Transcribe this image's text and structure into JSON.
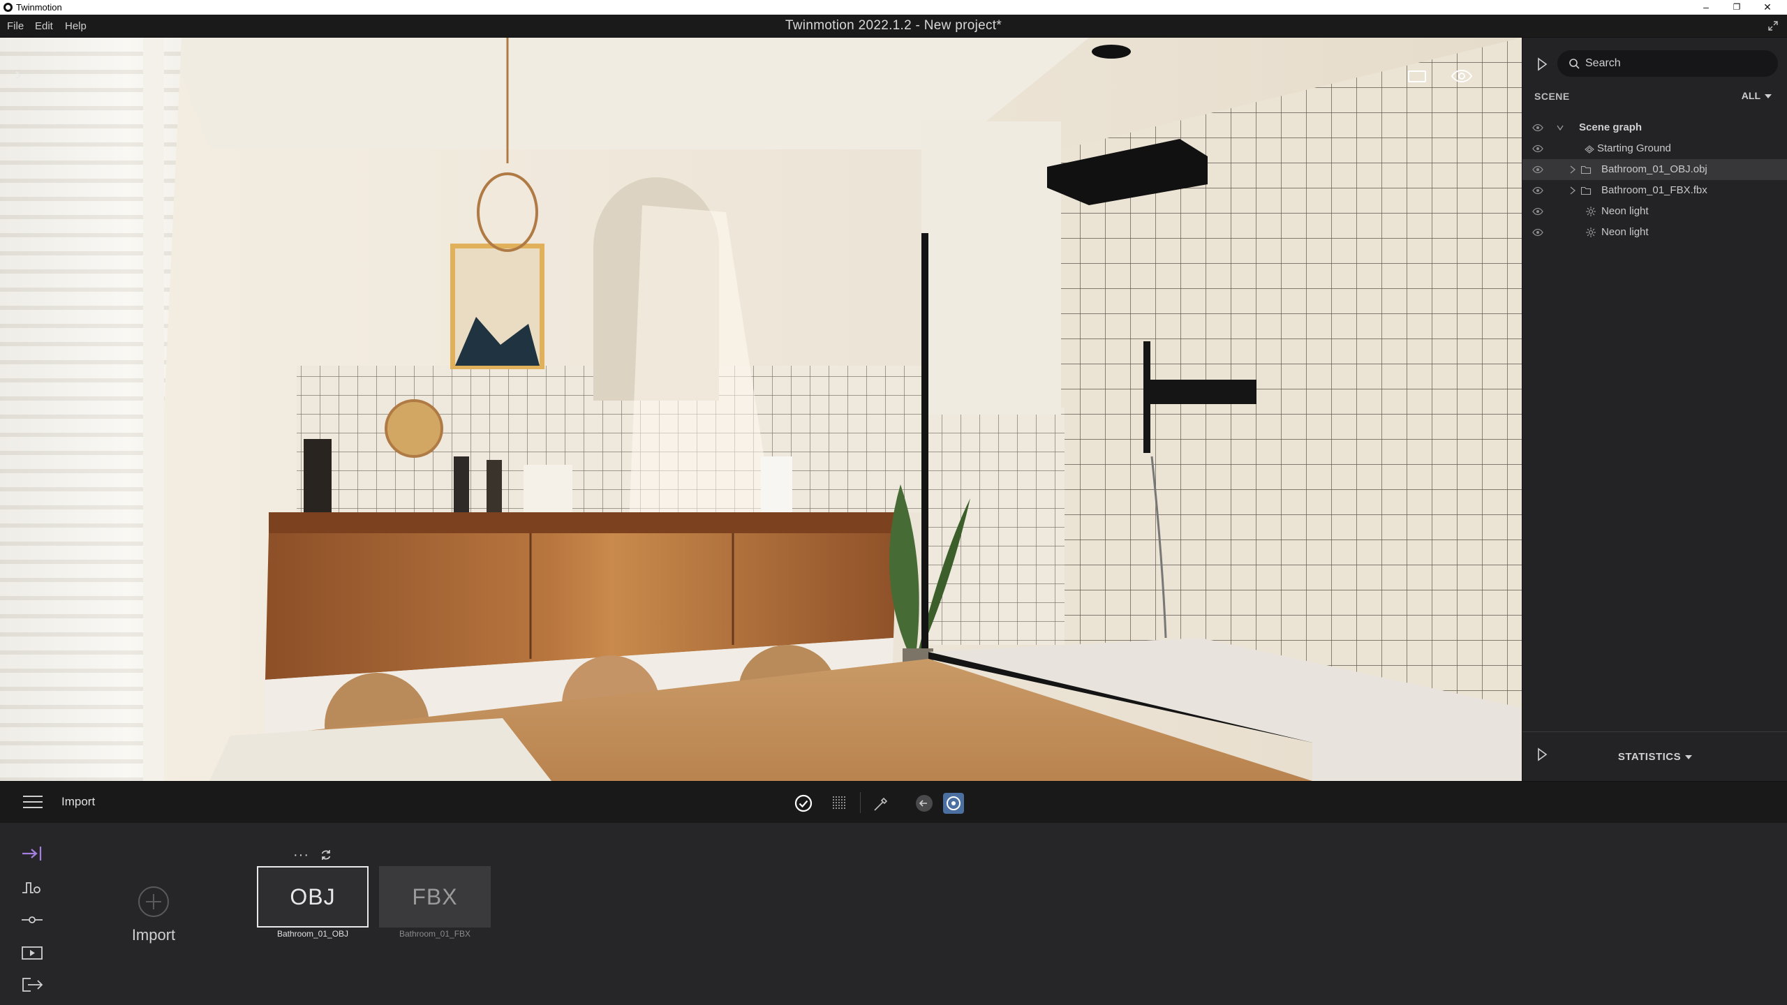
{
  "os_window": {
    "app_name": "Twinmotion",
    "minimize_glyph": "–",
    "restore_glyph": "❐",
    "close_glyph": "✕"
  },
  "menubar": {
    "items": [
      "File",
      "Edit",
      "Help"
    ],
    "document_title": "Twinmotion 2022.1.2 - New project*"
  },
  "viewport": {
    "icons": [
      "expand-arrow-icon",
      "aspect-ratio-icon",
      "eye-view-icon"
    ]
  },
  "scene_panel": {
    "search_placeholder": "Search",
    "section_title": "SCENE",
    "filter_label": "ALL",
    "tree": [
      {
        "label": "Scene graph",
        "kind": "root",
        "icon": "chevron-down-icon"
      },
      {
        "label": "Starting Ground",
        "kind": "ground",
        "icon": "ground-icon"
      },
      {
        "label": "Bathroom_01_OBJ.obj",
        "kind": "folder",
        "icon": "folder-icon",
        "selected": true
      },
      {
        "label": "Bathroom_01_FBX.fbx",
        "kind": "folder",
        "icon": "folder-icon"
      },
      {
        "label": "Neon light",
        "kind": "light",
        "icon": "light-icon"
      },
      {
        "label": "Neon light",
        "kind": "light",
        "icon": "light-icon"
      }
    ],
    "statistics_label": "STATISTICS"
  },
  "bottom_toolbar": {
    "panel_title": "Import",
    "tools": [
      "checkmark-icon",
      "grid-icon",
      "pipette-icon",
      "back-icon",
      "orbit-icon"
    ]
  },
  "bottom_panel": {
    "rail_icons": [
      "import-rail-icon",
      "context-rail-icon",
      "settings-rail-icon",
      "media-rail-icon",
      "export-rail-icon"
    ],
    "import_label": "Import",
    "assets": [
      {
        "thumb_text": "OBJ",
        "caption": "Bathroom_01_OBJ",
        "selected": true
      },
      {
        "thumb_text": "FBX",
        "caption": "Bathroom_01_FBX",
        "selected": false
      }
    ],
    "more_glyph": "···"
  },
  "colors": {
    "accent_purple": "#9b7bd6",
    "toolbar_active": "#4a6fa0",
    "panel_bg": "#232325"
  }
}
